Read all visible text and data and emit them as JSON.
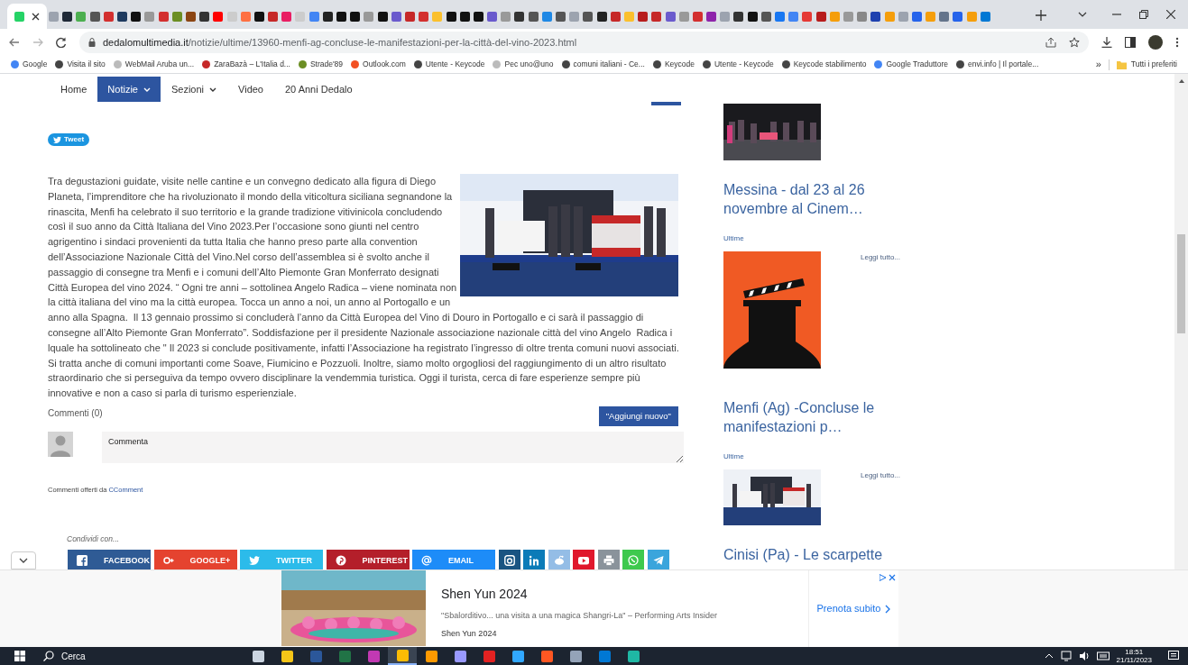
{
  "browser": {
    "tabs": [
      {
        "color": "#25d366",
        "selected": true
      },
      {
        "color": "#9ca3af",
        "selected": false
      },
      {
        "color": "#1f2937",
        "selected": false
      },
      {
        "color": "#4caf50",
        "selected": false
      },
      {
        "color": "#555555",
        "selected": false
      },
      {
        "color": "#d32f2f",
        "selected": false
      },
      {
        "color": "#1e3a5f",
        "selected": false
      },
      {
        "color": "#111111",
        "selected": false
      },
      {
        "color": "#999999",
        "selected": false
      },
      {
        "color": "#d32f2f",
        "selected": false
      },
      {
        "color": "#6b8e23",
        "selected": false
      },
      {
        "color": "#8b4513",
        "selected": false
      },
      {
        "color": "#333333",
        "selected": false
      },
      {
        "color": "#ff0000",
        "selected": false
      },
      {
        "color": "#cccccc",
        "selected": false
      },
      {
        "color": "#ff7043",
        "selected": false
      },
      {
        "color": "#111111",
        "selected": false
      },
      {
        "color": "#c62828",
        "selected": false
      },
      {
        "color": "#e91e63",
        "selected": false
      },
      {
        "color": "#cccccc",
        "selected": false
      },
      {
        "color": "#4285f4",
        "selected": false
      },
      {
        "color": "#222222",
        "selected": false
      },
      {
        "color": "#111111",
        "selected": false
      },
      {
        "color": "#111111",
        "selected": false
      },
      {
        "color": "#999999",
        "selected": false
      },
      {
        "color": "#111111",
        "selected": false
      },
      {
        "color": "#6a5acd",
        "selected": false
      },
      {
        "color": "#c62828",
        "selected": false
      },
      {
        "color": "#d32f2f",
        "selected": false
      },
      {
        "color": "#fbc02d",
        "selected": false
      },
      {
        "color": "#111111",
        "selected": false
      },
      {
        "color": "#111111",
        "selected": false
      },
      {
        "color": "#111111",
        "selected": false
      },
      {
        "color": "#6a5acd",
        "selected": false
      },
      {
        "color": "#999999",
        "selected": false
      },
      {
        "color": "#333333",
        "selected": false
      },
      {
        "color": "#555555",
        "selected": false
      },
      {
        "color": "#1e88e5",
        "selected": false
      },
      {
        "color": "#555555",
        "selected": false
      },
      {
        "color": "#9ca3af",
        "selected": false
      },
      {
        "color": "#555555",
        "selected": false
      },
      {
        "color": "#222222",
        "selected": false
      },
      {
        "color": "#c62828",
        "selected": false
      },
      {
        "color": "#fbc02d",
        "selected": false
      },
      {
        "color": "#b71c1c",
        "selected": false
      },
      {
        "color": "#c62828",
        "selected": false
      },
      {
        "color": "#6a5acd",
        "selected": false
      },
      {
        "color": "#999999",
        "selected": false
      },
      {
        "color": "#d32f2f",
        "selected": false
      },
      {
        "color": "#8e24aa",
        "selected": false
      },
      {
        "color": "#9ca3af",
        "selected": false
      },
      {
        "color": "#333333",
        "selected": false
      },
      {
        "color": "#111111",
        "selected": false
      },
      {
        "color": "#555555",
        "selected": false
      },
      {
        "color": "#1877f2",
        "selected": false
      },
      {
        "color": "#4285f4",
        "selected": false
      },
      {
        "color": "#e53935",
        "selected": false
      },
      {
        "color": "#b71c1c",
        "selected": false
      },
      {
        "color": "#f59e0b",
        "selected": false
      },
      {
        "color": "#999999",
        "selected": false
      },
      {
        "color": "#888888",
        "selected": false
      },
      {
        "color": "#1e40af",
        "selected": false
      },
      {
        "color": "#f59e0b",
        "selected": false
      },
      {
        "color": "#9ca3af",
        "selected": false
      },
      {
        "color": "#2563eb",
        "selected": false
      },
      {
        "color": "#f59e0b",
        "selected": false
      },
      {
        "color": "#64748b",
        "selected": false
      },
      {
        "color": "#2563eb",
        "selected": false
      },
      {
        "color": "#f59e0b",
        "selected": false
      },
      {
        "color": "#0078d4",
        "selected": false
      }
    ],
    "address": {
      "domain": "dedalomultimedia.it",
      "path": "/notizie/ultime/13960-menfi-ag-concluse-le-manifestazioni-per-la-città-del-vino-2023.html"
    },
    "bookmarks": [
      {
        "label": "Google",
        "color": "#4285f4"
      },
      {
        "label": "Visita il sito",
        "color": "#444444"
      },
      {
        "label": "WebMail Aruba un...",
        "color": "#bbbbbb"
      },
      {
        "label": "ZaraBazà – L'Italia d...",
        "color": "#c62828"
      },
      {
        "label": "Strade'89",
        "color": "#6b8e23"
      },
      {
        "label": "Outlook.com",
        "color": "#f25022"
      },
      {
        "label": "Utente - Keycode",
        "color": "#444444"
      },
      {
        "label": "Pec uno@uno",
        "color": "#bbbbbb"
      },
      {
        "label": "comuni italiani - Ce...",
        "color": "#444444"
      },
      {
        "label": "Keycode",
        "color": "#444444"
      },
      {
        "label": "Utente - Keycode",
        "color": "#444444"
      },
      {
        "label": "Keycode stabilimento",
        "color": "#444444"
      },
      {
        "label": "Google Traduttore",
        "color": "#4285f4"
      },
      {
        "label": "envi.info | Il portale...",
        "color": "#444444"
      }
    ],
    "bookmarks_more": "»",
    "all_bookmarks": "Tutti i preferiti"
  },
  "nav": [
    {
      "label": "Home",
      "selected": false,
      "dropdown": false
    },
    {
      "label": "Notizie",
      "selected": true,
      "dropdown": true
    },
    {
      "label": "Sezioni",
      "selected": false,
      "dropdown": true
    },
    {
      "label": "Video",
      "selected": false,
      "dropdown": false
    },
    {
      "label": "20 Anni Dedalo",
      "selected": false,
      "dropdown": false
    }
  ],
  "article": {
    "tweet": "Tweet",
    "body": "Tra degustazioni guidate, visite nelle cantine e un convegno dedicato alla figura di Diego Planeta, l’imprenditore che ha rivoluzionato il mondo della viticoltura siciliana segnandone la rinascita, Menfi ha celebrato il suo territorio e la grande tradizione vitivinicola concludendo così il suo anno da Città Italiana del Vino 2023.Per l’occasione sono giunti nel centro agrigentino i sindaci provenienti da tutta Italia che hanno preso parte alla convention dell’Associazione Nazionale Città del Vino.Nel corso dell’assemblea si è svolto anche il passaggio di consegne tra Menfi e i comuni dell’Alto Piemonte Gran Monferrato designati Città Europea del vino 2024. “ Ogni tre anni – sottolinea Angelo Radica – viene nominata non la città italiana del vino ma la città europea. Tocca un anno a noi, un anno al Portogallo e un",
    "body_continued": "anno alla Spagna.  Il 13 gennaio prossimo si concluderà l’anno da Città Europea del Vino di Douro in Portogallo e ci sarà il passaggio di consegne all’Alto Piemonte Gran Monferrato”. Soddisfazione per il presidente Nazionale associazione nazionale città del vino Angelo  Radica i lquale ha sottolineato che \" Il 2023 si conclude positivamente, infatti l’Associazione ha registrato l’ingresso di oltre trenta comuni nuovi associati. Si tratta anche di comuni importanti come Soave, Fiumicino e Pozzuoli. Inoltre, siamo molto orgogliosi del raggiungimento di un altro risultato straordinario che si perseguiva da tempo ovvero disciplinare la vendemmia turistica. Oggi il turista, cerca di fare esperienze sempre più innovative e non a caso si parla di turismo esperienziale."
  },
  "comments": {
    "count": "Commenti (0)",
    "add_button": "\"Aggiungi nuovo\"",
    "placeholder": "Commenta",
    "powered_by": "Commenti offerti da",
    "powered_link": "CComment"
  },
  "share": {
    "label": "Condividi con...",
    "buttons": [
      {
        "kind": "facebook",
        "label": "FACEBOOK",
        "color": "#2f5b95"
      },
      {
        "kind": "googleplus",
        "label": "GOOGLE+",
        "color": "#e5432f"
      },
      {
        "kind": "twitter",
        "label": "TWITTER",
        "color": "#2cbbea"
      },
      {
        "kind": "pinterest",
        "label": "PINTEREST",
        "color": "#b41f2a"
      },
      {
        "kind": "email",
        "label": "EMAIL",
        "color": "#1d8cf8"
      },
      {
        "kind": "instagram",
        "color": "#1a5482"
      },
      {
        "kind": "linkedin",
        "color": "#0b7bb8"
      },
      {
        "kind": "reddit",
        "color": "#94bde6"
      },
      {
        "kind": "youtube",
        "color": "#e0182d"
      },
      {
        "kind": "print",
        "color": "#8a939b"
      },
      {
        "kind": "whatsapp",
        "color": "#3ec94e"
      },
      {
        "kind": "telegram",
        "color": "#3aa5dc"
      }
    ]
  },
  "sidebar": [
    {
      "kind": "night-photo"
    },
    {
      "kind": "article",
      "title": "Messina - dal 23 al 26 novembre al Cinem…",
      "category": "Ultime",
      "read_more": "Leggi tutto..."
    },
    {
      "kind": "article",
      "title": "Menfi (Ag) -Concluse le manifestazioni p…",
      "category": "Ultime",
      "read_more": "Leggi tutto..."
    },
    {
      "kind": "article",
      "title": "Cinisi (Pa) - Le scarpette"
    }
  ],
  "ad": {
    "title": "Shen Yun 2024",
    "quote": "\"Sbalorditivo... una visita a una magica Shangri-La\" – Performing Arts Insider",
    "source": "Shen Yun 2024",
    "cta": "Prenota subito"
  },
  "taskbar": {
    "search": "Cerca",
    "apps": [
      {
        "color": "#cbd5e1",
        "selected": false
      },
      {
        "color": "#f5c518",
        "selected": false
      },
      {
        "color": "#2b579a",
        "selected": false
      },
      {
        "color": "#217346",
        "selected": false
      },
      {
        "color": "#c239b3",
        "selected": false
      },
      {
        "color": "#fbbc05",
        "selected": true
      },
      {
        "color": "#ff9a00",
        "selected": false
      },
      {
        "color": "#9999ff",
        "selected": false
      },
      {
        "color": "#e32222",
        "selected": false
      },
      {
        "color": "#31a8ff",
        "selected": false
      },
      {
        "color": "#ff5722",
        "selected": false
      },
      {
        "color": "#94a3b8",
        "selected": false
      },
      {
        "color": "#0078d4",
        "selected": false
      },
      {
        "color": "#1fb8a4",
        "selected": false
      }
    ],
    "time": "18:51",
    "date": "21/11/2023"
  }
}
